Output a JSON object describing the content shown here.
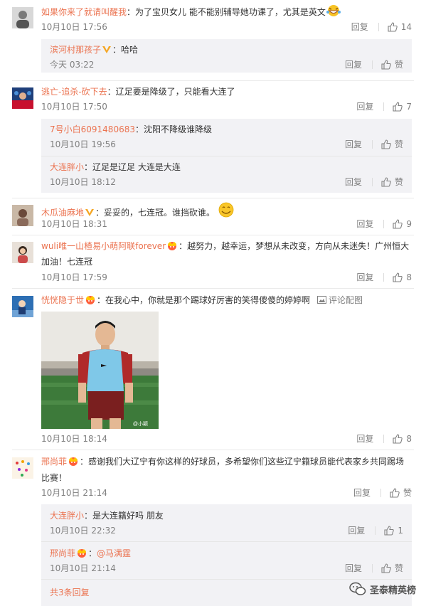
{
  "comments": [
    {
      "user": "如果你来了就请叫醒我",
      "text": "：为了宝贝女儿 能不能别辅导她功课了，尤其是英文",
      "time": "10月10日 17:56",
      "reply": "回复",
      "likes": "14",
      "subs": [
        {
          "user": "滨河村那孩子",
          "text": "：哈哈",
          "time": "今天 03:22",
          "reply": "回复",
          "likes": "赞"
        }
      ]
    },
    {
      "user": "逃亡-追杀-砍下去",
      "text": "：辽足要是降级了，只能看大连了",
      "time": "10月10日 17:50",
      "reply": "回复",
      "likes": "7",
      "subs": [
        {
          "user": "7号小白6091480683",
          "text": "：沈阳不降级谁降级",
          "time": "10月10日 19:56",
          "reply": "回复",
          "likes": "赞"
        },
        {
          "user": "大连胖小",
          "text": "：辽足是辽足 大连是大连",
          "time": "10月10日 18:12",
          "reply": "回复",
          "likes": "赞"
        }
      ]
    },
    {
      "user": "木瓜油麻地",
      "text": "：妥妥的，七连冠。谁挡砍谁。",
      "time": "10月10日 18:31",
      "reply": "回复",
      "likes": "9"
    },
    {
      "user": "wuli唯一山楂易小萌阿联forever",
      "text": "：越努力，越幸运，梦想从未改变，方向从未迷失！广州恒大",
      "text2": "加油！七连冠",
      "time": "10月10日 17:59",
      "reply": "回复",
      "likes": "8"
    },
    {
      "user": "恍恍隐于世",
      "text": "：在我心中，你就是那个踢球好厉害的笑得傻傻的婷婷啊",
      "pic_link": "评论配图",
      "watermark": "@小颖",
      "time": "10月10日 18:14",
      "reply": "回复",
      "likes": "8"
    },
    {
      "user": "邢尚菲",
      "text": "：感谢我们大辽宁有你这样的好球员，多希望你们这些辽宁籍球员能代表家乡共同踢场",
      "text2": "比赛！",
      "time": "10月10日 21:14",
      "reply": "回复",
      "likes": "赞",
      "subs": [
        {
          "user": "大连胖小",
          "text": "：是大连籍好吗 朋友",
          "time": "10月10日 22:32",
          "reply": "回复",
          "likes": "1"
        },
        {
          "user": "邢尚菲",
          "text": "：",
          "mention": "@马满霆",
          "time": "10月10日 21:14",
          "reply": "回复",
          "likes": "赞"
        }
      ],
      "more": "共3条回复"
    }
  ],
  "watermark": {
    "label": "圣泰精英榜"
  },
  "colors": {
    "link": "#eb7350",
    "meta": "#808080",
    "subbg": "#f2f2f5"
  }
}
